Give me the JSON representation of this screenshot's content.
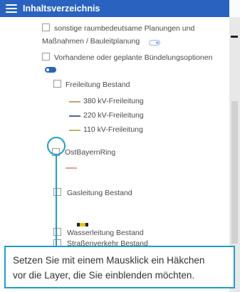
{
  "header": {
    "title": "Inhaltsverzeichnis",
    "menu_icon": "hamburger-menu-icon"
  },
  "layers": {
    "item_raumbedeutsam_line1": "sonstige raumbedeutsame Planungen und",
    "item_raumbedeutsam_line2": "Maßnahmen / Bauleitplanung",
    "item_buendelung": "Vorhandene oder geplante Bündelungsoptionen",
    "freileitung_group": "Freileitung Bestand",
    "freileitung_legend": [
      {
        "label": "380 kV-Freileitung",
        "color": "#c9a07a"
      },
      {
        "label": "220 kV-Freileitung",
        "color": "#5a5fb0"
      },
      {
        "label": "110 kV-Freileitung",
        "color": "#b5b86a"
      }
    ],
    "ostbayernring": "OstBayernRing",
    "ostbayernring_color": "#d9a98a",
    "gasleitung": "Gasleitung Bestand",
    "gas_symbol_colors": [
      "#222222",
      "#e8c31a",
      "#222222"
    ],
    "wasserleitung": "Wasserleitung Bestand",
    "strassenverkehr": "Straßenverkehr Bestand"
  },
  "tooltip": {
    "line1": "Setzen Sie mit einem Mausklick ein Häkchen",
    "line2": "vor die Layer, die Sie einblenden möchten."
  },
  "colors": {
    "header_bg": "#2a63bf",
    "highlight": "#1f9fc9"
  }
}
